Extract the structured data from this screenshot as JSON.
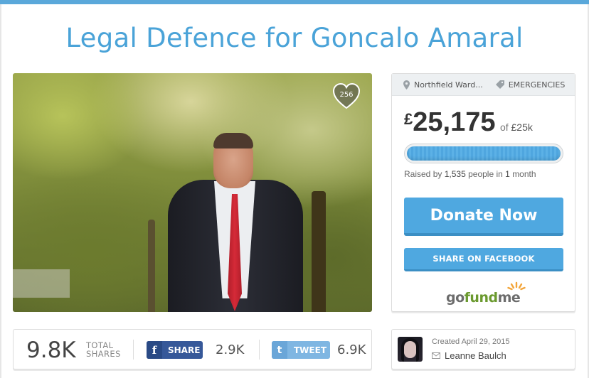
{
  "campaign": {
    "title": "Legal Defence for Goncalo Amaral",
    "hearts": "256"
  },
  "card": {
    "location": "Northfield Ward...",
    "category": "EMERGENCIES",
    "currency": "£",
    "amount": "25,175",
    "goal_prefix": "of",
    "goal": "£25k",
    "progress_fraction": 1.0,
    "raised_by_prefix": "Raised by",
    "people": "1,535",
    "raised_by_mid": "people in",
    "duration_num": "1",
    "duration_unit": "month",
    "donate_label": "Donate Now",
    "facebook_label": "SHARE ON FACEBOOK",
    "logo": {
      "go": "go",
      "fund": "fund",
      "me": "me"
    }
  },
  "shares": {
    "total": "9.8K",
    "total_label_1": "TOTAL",
    "total_label_2": "SHARES",
    "fb_label": "SHARE",
    "fb_count": "2.9K",
    "tw_label": "TWEET",
    "tw_count": "6.9K"
  },
  "organizer": {
    "created": "Created April 29, 2015",
    "name": "Leanne Baulch"
  },
  "colors": {
    "accent": "#4fa8e0",
    "title": "#4aa3d8",
    "facebook": "#365899",
    "twitter": "#7fb6e2"
  }
}
